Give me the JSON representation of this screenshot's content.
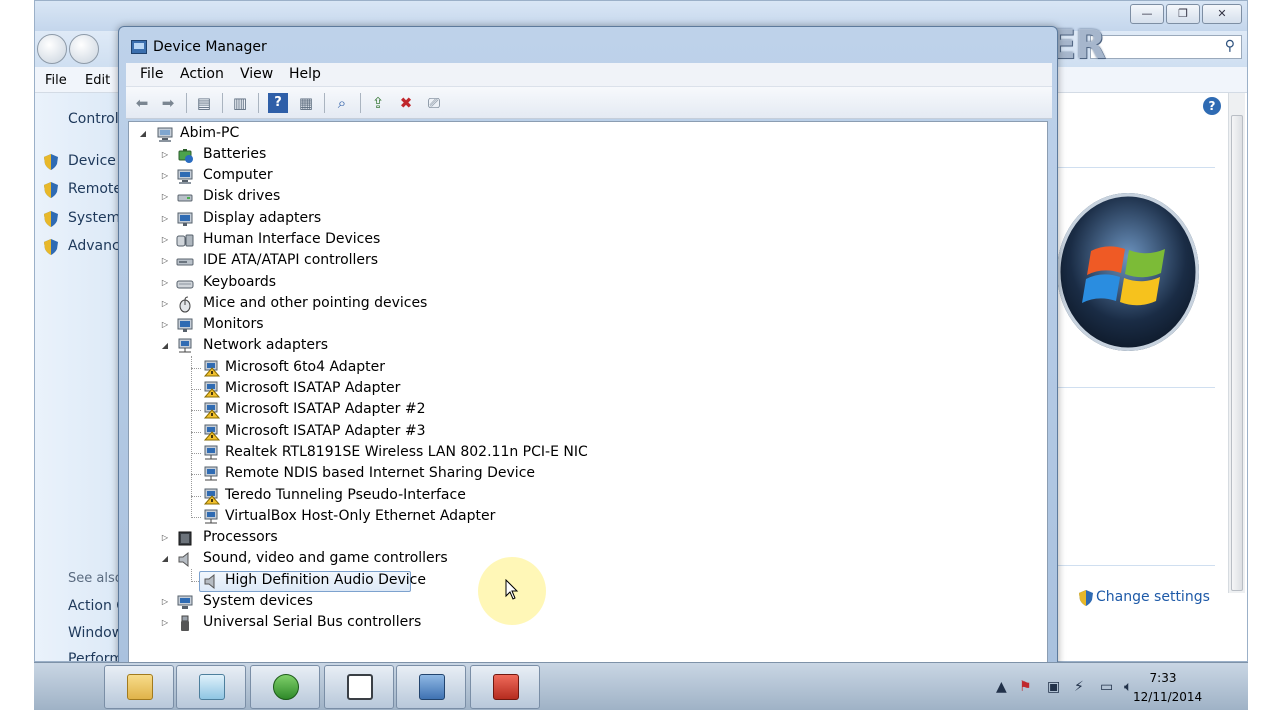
{
  "background_window": {
    "menu": [
      "File",
      "Edit"
    ],
    "left_pane": {
      "header": "Control",
      "tasks": [
        "Device M",
        "Remote",
        "System",
        "Advanc"
      ],
      "see_also_header": "See also",
      "see_also": [
        "Action C",
        "Window",
        "Perform"
      ]
    },
    "change_settings": "Change settings",
    "watermark": "WINUSER"
  },
  "device_manager": {
    "title": "Device Manager",
    "menu": [
      "File",
      "Action",
      "View",
      "Help"
    ],
    "tree": {
      "root": "Abim-PC",
      "categories": [
        {
          "label": "Batteries",
          "expanded": false
        },
        {
          "label": "Computer",
          "expanded": false
        },
        {
          "label": "Disk drives",
          "expanded": false
        },
        {
          "label": "Display adapters",
          "expanded": false
        },
        {
          "label": "Human Interface Devices",
          "expanded": false
        },
        {
          "label": "IDE ATA/ATAPI controllers",
          "expanded": false
        },
        {
          "label": "Keyboards",
          "expanded": false
        },
        {
          "label": "Mice and other pointing devices",
          "expanded": false
        },
        {
          "label": "Monitors",
          "expanded": false
        },
        {
          "label": "Network adapters",
          "expanded": true
        },
        {
          "label": "Processors",
          "expanded": false
        },
        {
          "label": "Sound, video and game controllers",
          "expanded": true
        },
        {
          "label": "System devices",
          "expanded": false
        },
        {
          "label": "Universal Serial Bus controllers",
          "expanded": false
        }
      ],
      "network_adapters": [
        {
          "label": "Microsoft 6to4 Adapter",
          "warning": true
        },
        {
          "label": "Microsoft ISATAP Adapter",
          "warning": true
        },
        {
          "label": "Microsoft ISATAP Adapter #2",
          "warning": true
        },
        {
          "label": "Microsoft ISATAP Adapter #3",
          "warning": true
        },
        {
          "label": "Realtek RTL8191SE Wireless LAN 802.11n PCI-E NIC",
          "warning": false
        },
        {
          "label": "Remote NDIS based Internet Sharing Device",
          "warning": false
        },
        {
          "label": "Teredo Tunneling Pseudo-Interface",
          "warning": true
        },
        {
          "label": "VirtualBox Host-Only Ethernet Adapter",
          "warning": false
        }
      ],
      "sound_devices": [
        {
          "label": "High Definition Audio Device",
          "selected": true
        }
      ]
    }
  },
  "taskbar": {
    "clock_time": "7:33",
    "clock_date": "12/11/2014"
  },
  "colors": {
    "accent": "#1e5aa8",
    "warning": "#f2c12e",
    "selection": "#dde9f7"
  }
}
